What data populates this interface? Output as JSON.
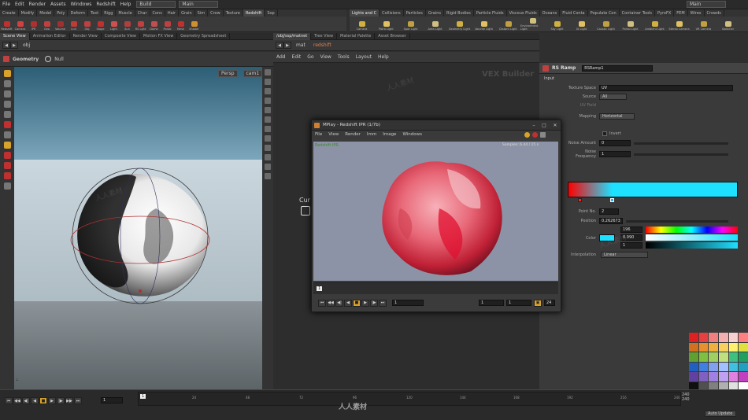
{
  "menubar": {
    "items": [
      "File",
      "Edit",
      "Render",
      "Assets",
      "Windows",
      "Redshift",
      "Help"
    ],
    "build_desktop": "Build",
    "main_dropdown": "Main",
    "right_dropdown": "Main"
  },
  "shelf_tabs_left": [
    "Create",
    "Modify",
    "Model",
    "Poly",
    "Deform",
    "Text",
    "Rigg",
    "Muscle",
    "Char",
    "Cons",
    "Hair",
    "Grain",
    "Sim",
    "Crow",
    "Texture",
    "Redshift",
    "Sop"
  ],
  "shelf_tabs_right": [
    "Lights and C",
    "Collisions",
    "Particles",
    "Grains",
    "Rigid Bodies",
    "Particle Fluids",
    "Viscous Fluids",
    "Oceans",
    "Fluid Conta",
    "Populate Con",
    "Container Tools",
    "PyroFX",
    "FEM",
    "Wires",
    "Crowds"
  ],
  "shelf_tools_left": [
    "Redshift",
    "Camera",
    "IPR",
    "Geo",
    "Volume",
    "Lnd",
    "Obj",
    "Stage",
    "Light",
    "Sun",
    "RS Lght",
    "Dome",
    "Portal",
    "Mesh",
    "Shader"
  ],
  "shelf_tools_right": [
    "Camera",
    "Point Light",
    "Spot Light",
    "Area Light",
    "Geometry Light",
    "Volume Light",
    "Distant Light",
    "Environment Light",
    "Sky Light",
    "GI Light",
    "Caustic Light",
    "Portal Light",
    "Ambient Light",
    "Stereo Camera",
    "VR Camera",
    "Switcher"
  ],
  "left_pane_tabs": [
    "Scene View",
    "Animation Editor",
    "Render View",
    "Composite View",
    "Motion FX View",
    "Geometry Spreadsheet"
  ],
  "left_path": "obj",
  "viewport_header": {
    "context": "Geometry",
    "node": "Null",
    "persp": "Persp",
    "cam": "cam1"
  },
  "center_pane_tabs": [
    "/obj/ssp/matnet",
    "Tree View",
    "Material Palette",
    "Asset Browser"
  ],
  "net_path": {
    "root": "mat",
    "node": "redshift"
  },
  "net_menu": [
    "Add",
    "Edit",
    "Go",
    "View",
    "Tools",
    "Layout",
    "Help"
  ],
  "net_label": "VEX Builder",
  "net_overlay_text": "Cur",
  "param": {
    "node_type": "RS Ramp",
    "node_name": "RSRamp1",
    "tab": "Input",
    "texture_space_label": "Texture Space",
    "texture_space_value": "UV",
    "source_label": "Source",
    "source_value": "All",
    "uv_field_label": "UV Field",
    "mapping_label": "Mapping",
    "mapping_value": "Horizontal",
    "invert_label": "Invert",
    "noise_amount_label": "Noise Amount",
    "noise_amount_value": "0",
    "noise_freq_label": "Noise Frequency",
    "noise_freq_value": "1",
    "point_no_label": "Point No.",
    "point_no_value": "2",
    "position_label": "Position",
    "position_value": "0.262673",
    "color_label": "Color",
    "color_h": "196",
    "color_s": "0.990",
    "color_v": "1",
    "interp_label": "Interpolation",
    "interp_value": "Linear",
    "ramp_left_color": "#ff0000",
    "ramp_right_color": "#1ee0ff"
  },
  "mplay": {
    "title": "MPlay - Redshift IPR (1/7b)",
    "menu": [
      "File",
      "View",
      "Render",
      "Imm",
      "Image",
      "Windows"
    ],
    "overlay_left": "Redshift IPR",
    "overlay_right": "Samples: 6.44 / 15 s",
    "frame_marker": "1",
    "frame_field": "1",
    "range_start": "1",
    "range_end": "1",
    "fps": "24"
  },
  "timeline": {
    "frame_marker": "1",
    "current_frame": "1",
    "ticks": [
      "24",
      "48",
      "72",
      "96",
      "120",
      "144",
      "168",
      "192",
      "216",
      "240"
    ],
    "end_a": "240",
    "end_b": "240",
    "auto_update": "Auto Update"
  },
  "palette_colors": [
    "#e02020",
    "#e84040",
    "#f08080",
    "#f4b0b0",
    "#f7d0d0",
    "#ff8080",
    "#d07020",
    "#e89030",
    "#f0b040",
    "#f8d060",
    "#fff070",
    "#e0e040",
    "#60a030",
    "#80c040",
    "#a0d060",
    "#c0e080",
    "#40c080",
    "#20a060",
    "#2060c0",
    "#4080e0",
    "#80a0f0",
    "#a0c0ff",
    "#40c0e0",
    "#20a0c0",
    "#6040a0",
    "#8060c0",
    "#a080e0",
    "#c0a0f0",
    "#e080e0",
    "#c040c0",
    "#101010",
    "#505050",
    "#808080",
    "#b0b0b0",
    "#e0e0e0",
    "#ffffff"
  ],
  "watermark": "人人素材"
}
